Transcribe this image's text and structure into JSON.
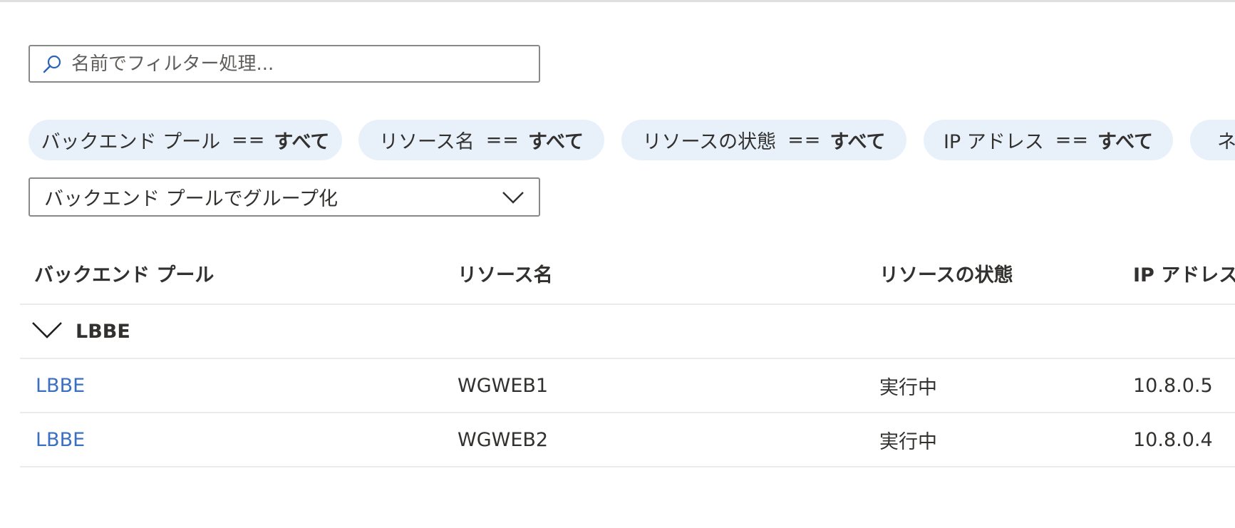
{
  "search": {
    "placeholder": "名前でフィルター処理..."
  },
  "filters": [
    {
      "field": "バックエンド プール",
      "op": "==",
      "value": "すべて"
    },
    {
      "field": "リソース名",
      "op": "==",
      "value": "すべて"
    },
    {
      "field": "リソースの状態",
      "op": "==",
      "value": "すべて"
    },
    {
      "field": "IP アドレス",
      "op": "==",
      "value": "すべて"
    },
    {
      "field": "ネ",
      "op": "",
      "value": ""
    }
  ],
  "group_by": {
    "selected": "バックエンド プールでグループ化"
  },
  "table": {
    "columns": [
      "バックエンド プール",
      "リソース名",
      "リソースの状態",
      "IP アドレス"
    ],
    "groups": [
      {
        "name": "LBBE",
        "rows": [
          {
            "pool": "LBBE",
            "resource": "WGWEB1",
            "state": "実行中",
            "ip": "10.8.0.5"
          },
          {
            "pool": "LBBE",
            "resource": "WGWEB2",
            "state": "実行中",
            "ip": "10.8.0.4"
          }
        ]
      }
    ]
  },
  "colors": {
    "link": "#3a6fc2",
    "pill_bg": "#e8f1fa",
    "border": "#8a8886",
    "divider": "#edebe9"
  }
}
